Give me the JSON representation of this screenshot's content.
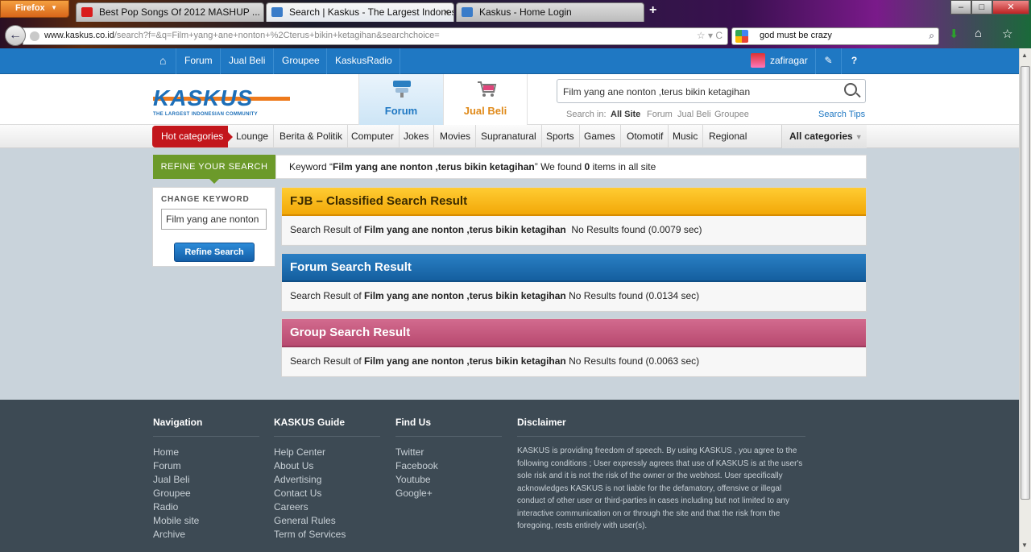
{
  "browser": {
    "app_button": "Firefox",
    "tabs": [
      {
        "title": "Best Pop Songs Of 2012 MASHUP ..."
      },
      {
        "title": "Search | Kaskus - The Largest Indonesi..."
      },
      {
        "title": "Kaskus - Home Login"
      }
    ],
    "url_domain": "www.kaskus.co.id",
    "url_rest": "/search?f=&q=Film+yang+ane+nonton+%2Cterus+bikin+ketagihan&searchchoice=",
    "search_query": "god must be crazy",
    "colors": {
      "youtube": "#d91c1c",
      "kaskus_fav": "#3a7cc9"
    }
  },
  "topnav": {
    "items": [
      "Forum",
      "Jual Beli",
      "Groupee",
      "KaskusRadio"
    ],
    "username": "zafiragar"
  },
  "header": {
    "logo_text": "KASKUS",
    "logo_sub": "THE LARGEST INDONESIAN COMMUNITY",
    "tiles": [
      "Forum",
      "Jual Beli"
    ],
    "search_value": "Film yang ane nonton ,terus bikin ketagihan",
    "search_in_label": "Search in:",
    "search_filters": [
      "All Site",
      "Forum",
      "Jual Beli",
      "Groupee"
    ],
    "search_tips": "Search Tips"
  },
  "categories": {
    "hot": "Hot categories",
    "items": [
      "Lounge",
      "Berita & Politik",
      "Computer",
      "Jokes",
      "Movies",
      "Supranatural",
      "Sports",
      "Games",
      "Otomotif",
      "Music",
      "Regional"
    ],
    "all": "All categories"
  },
  "refine": {
    "label": "REFINE YOUR SEARCH",
    "kw_prefix": "Keyword “",
    "kw_value": "Film yang ane nonton ,terus bikin ketagihan",
    "kw_mid": "” We found ",
    "kw_count": "0",
    "kw_suffix": " items in all site",
    "change_label": "CHANGE KEYWORD",
    "input_value": "Film yang ane nonton",
    "button": "Refine Search"
  },
  "results": [
    {
      "title": "FJB – Classified Search Result",
      "prefix": "Search Result of ",
      "query": "Film yang ane nonton ,terus bikin ketagihan",
      "status": "  No Results found (0.0079 sec)"
    },
    {
      "title": "Forum Search Result",
      "prefix": "Search Result of ",
      "query": "Film yang ane nonton ,terus bikin ketagihan",
      "status": " No Results found (0.0134 sec)"
    },
    {
      "title": "Group Search Result",
      "prefix": "Search Result of ",
      "query": "Film yang ane nonton ,terus bikin ketagihan",
      "status": " No Results found (0.0063 sec)"
    }
  ],
  "footer": {
    "navigation": {
      "title": "Navigation",
      "links": [
        "Home",
        "Forum",
        "Jual Beli",
        "Groupee",
        "Radio",
        "Mobile site",
        "Archive"
      ]
    },
    "guide": {
      "title": "KASKUS Guide",
      "links": [
        "Help Center",
        "About Us",
        "Advertising",
        "Contact Us",
        "Careers",
        "General Rules",
        "Term of Services"
      ]
    },
    "findus": {
      "title": "Find Us",
      "links": [
        "Twitter",
        "Facebook",
        "Youtube",
        "Google+"
      ]
    },
    "disclaimer": {
      "title": "Disclaimer",
      "text": "KASKUS is providing freedom of speech. By using KASKUS , you agree to the following conditions ; User expressly agrees that use of KASKUS is at the user's sole risk and it is not the risk of the owner or the webhost. User specifically acknowledges KASKUS is not liable for the defamatory, offensive or illegal conduct of other user or third-parties in cases including but not limited to any interactive communication on or through the site and that the risk from the foregoing, rests entirely with user(s)."
    }
  }
}
